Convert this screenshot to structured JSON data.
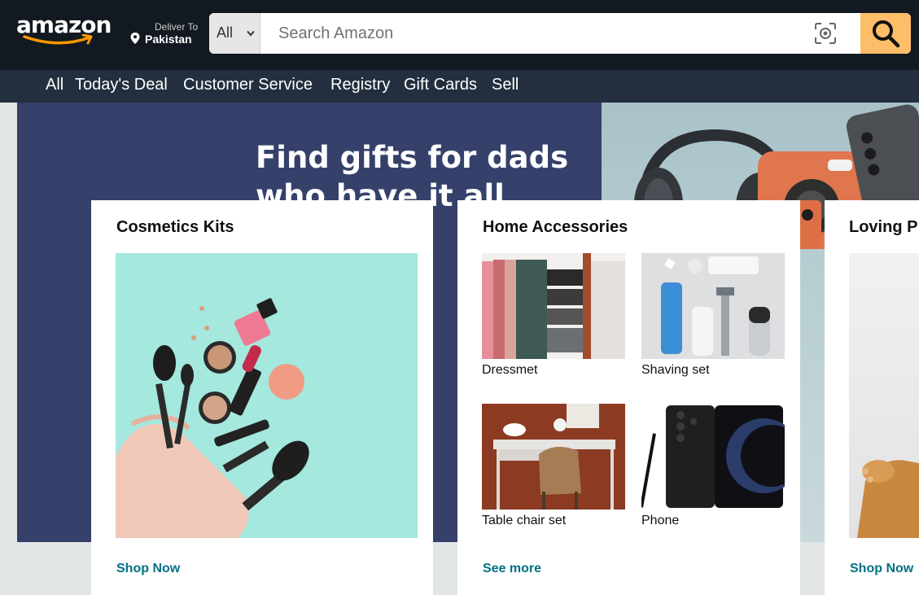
{
  "header": {
    "logo_text": "amazon",
    "deliver_label": "Deliver To",
    "deliver_country": "Pakistan",
    "search_category": "All",
    "search_placeholder": "Search Amazon",
    "search_icon": "search-icon",
    "lens_icon": "camera-lens-icon",
    "accent_color": "#febd69"
  },
  "nav": {
    "items": [
      "All",
      "Today's Deal",
      "Customer Service",
      "Registry",
      "Gift Cards",
      "Sell"
    ]
  },
  "hero": {
    "title": "Find gifts for dads who have it all"
  },
  "cards": [
    {
      "title": "Cosmetics Kits",
      "link": "Shop Now"
    },
    {
      "title": "Home Accessories",
      "tiles": [
        {
          "label": "Dressmet"
        },
        {
          "label": "Shaving set"
        },
        {
          "label": "Table chair set"
        },
        {
          "label": "Phone"
        }
      ],
      "link": "See more"
    },
    {
      "title": "Loving P",
      "link": "Shop Now"
    }
  ]
}
